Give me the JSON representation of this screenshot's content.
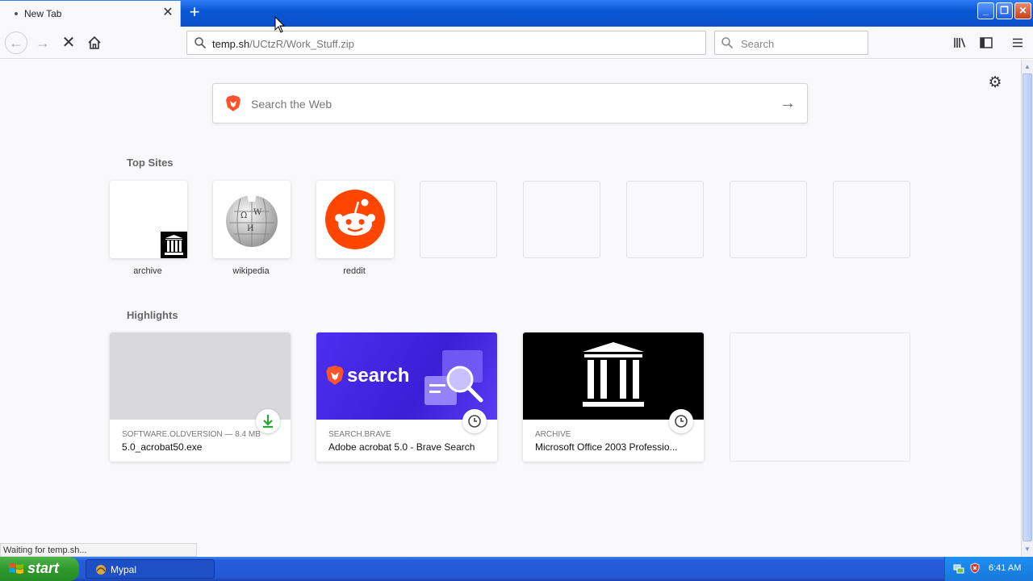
{
  "tab": {
    "title": "New Tab",
    "close": "✕",
    "new_tab": "+"
  },
  "window_controls": {
    "minimize": "_",
    "restore": "❐",
    "close": "✕"
  },
  "nav": {
    "url_host": "temp.sh",
    "url_path": "/UCtzR/Work_Stuff.zip",
    "search_placeholder": "Search"
  },
  "newtab": {
    "web_search_placeholder": "Search the Web",
    "top_sites_title": "Top Sites",
    "top_sites": [
      {
        "label": "archive"
      },
      {
        "label": "wikipedia"
      },
      {
        "label": "reddit"
      }
    ],
    "highlights_title": "Highlights",
    "highlights": [
      {
        "meta": "SOFTWARE.OLDVERSION — 8.4 MB",
        "title": "5.0_acrobat50.exe",
        "badge": "download-icon"
      },
      {
        "meta": "SEARCH.BRAVE",
        "title": "Adobe acrobat 5.0 - Brave Search",
        "thumb_text": "search",
        "badge": "clock-icon"
      },
      {
        "meta": "ARCHIVE",
        "title": "Microsoft Office 2003 Professio...",
        "badge": "clock-icon"
      }
    ]
  },
  "status": "Waiting for temp.sh...",
  "taskbar": {
    "start": "start",
    "task": "Mypal",
    "time": "6:41 AM"
  },
  "colors": {
    "brave": "#fb542b",
    "reddit": "#ff4500",
    "brave_thumb": "#4327e8",
    "download_green": "#2aa534"
  }
}
